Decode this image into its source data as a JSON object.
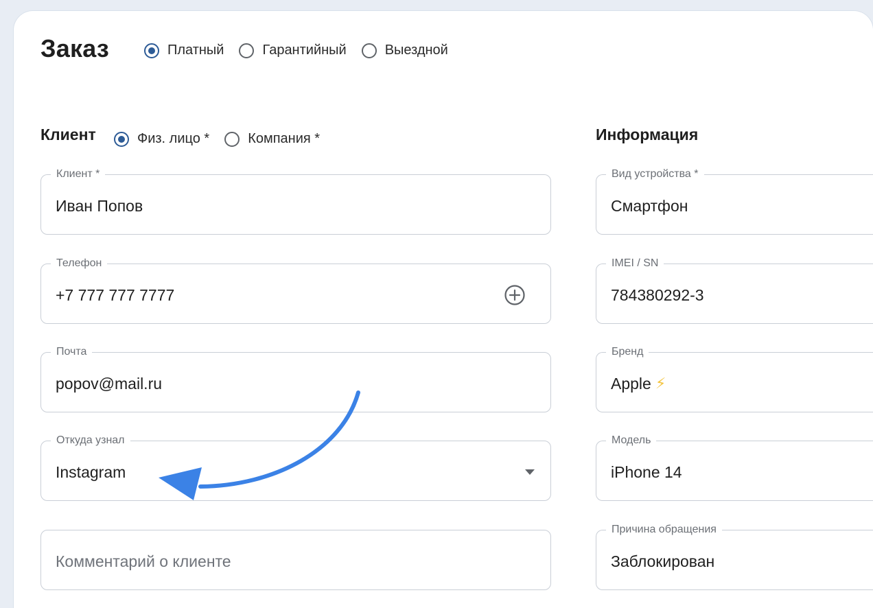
{
  "order": {
    "title": "Заказ",
    "types": [
      {
        "label": "Платный",
        "checked": true
      },
      {
        "label": "Гарантийный",
        "checked": false
      },
      {
        "label": "Выездной",
        "checked": false
      }
    ]
  },
  "client": {
    "title": "Клиент",
    "types": [
      {
        "label": "Физ. лицо *",
        "checked": true
      },
      {
        "label": "Компания *",
        "checked": false
      }
    ],
    "fields": {
      "name": {
        "label": "Клиент *",
        "value": "Иван Попов"
      },
      "phone": {
        "label": "Телефон",
        "value": "+7 777 777 7777",
        "icon": "plus-circle-icon"
      },
      "email": {
        "label": "Почта",
        "value": "popov@mail.ru"
      },
      "source": {
        "label": "Откуда узнал",
        "value": "Instagram",
        "icon": "caret-down-icon"
      },
      "comment": {
        "placeholder": "Комментарий о клиенте"
      }
    }
  },
  "info": {
    "title": "Информация",
    "fields": {
      "device": {
        "label": "Вид устройства *",
        "value": "Смартфон"
      },
      "imei": {
        "label": "IMEI / SN",
        "value": "784380292-3"
      },
      "brand": {
        "label": "Бренд",
        "value": "Apple",
        "badge": "⚡"
      },
      "model": {
        "label": "Модель",
        "value": "iPhone 14"
      },
      "reason": {
        "label": "Причина обращения",
        "value": "Заблокирован"
      }
    }
  },
  "colors": {
    "accent": "#2d5b96",
    "annotation_arrow": "#3b82e6",
    "field_border": "#c9ced6"
  }
}
